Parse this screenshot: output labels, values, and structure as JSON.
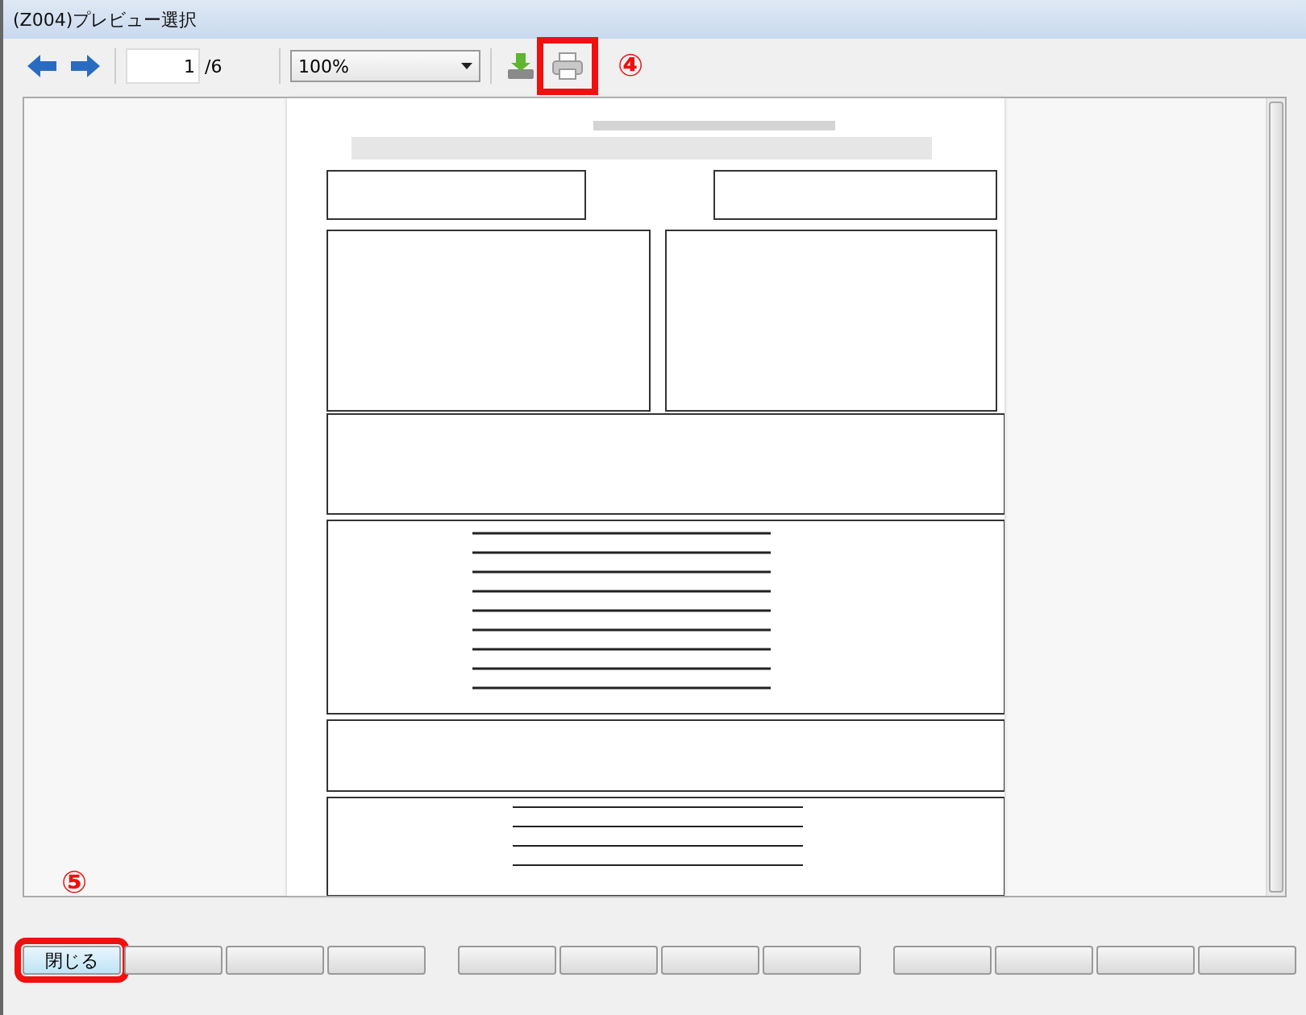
{
  "window": {
    "title": "(Z004)プレビュー選択"
  },
  "toolbar": {
    "page": "1",
    "page_total": "/6",
    "zoom": "100%",
    "print_highlighted": true
  },
  "annotations": [
    {
      "label": "④"
    },
    {
      "label": "⑤"
    }
  ],
  "button_groups": [
    {
      "buttons": [
        {
          "label": "閉じる",
          "kind": "labeled",
          "highlighted": true
        },
        {
          "kind": "blank",
          "highlighted": false
        },
        {
          "kind": "blank",
          "highlighted": false
        },
        {
          "kind": "blank",
          "highlighted": false
        }
      ]
    },
    {
      "buttons": [
        {
          "kind": "blank",
          "highlighted": false
        },
        {
          "kind": "blank",
          "highlighted": false
        },
        {
          "kind": "blank",
          "highlighted": false
        },
        {
          "kind": "blank",
          "highlighted": false
        }
      ]
    },
    {
      "buttons": [
        {
          "kind": "blank",
          "highlighted": false
        },
        {
          "kind": "blank",
          "highlighted": false
        },
        {
          "kind": "blank",
          "highlighted": false
        },
        {
          "kind": "blank",
          "highlighted": false
        }
      ]
    }
  ]
}
